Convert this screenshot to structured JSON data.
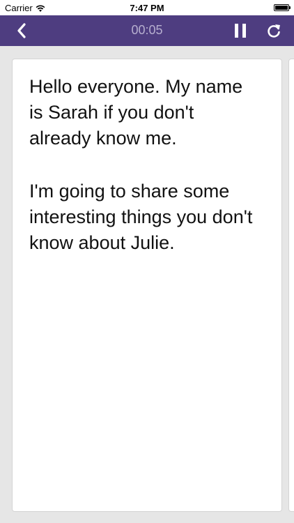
{
  "status_bar": {
    "carrier": "Carrier",
    "time": "7:47 PM",
    "wifi_icon": "wifi-icon",
    "battery_icon": "battery-icon"
  },
  "nav": {
    "back_icon": "chevron-left-icon",
    "timer": "00:05",
    "pause_icon": "pause-icon",
    "restart_icon": "refresh-icon"
  },
  "card": {
    "paragraphs": [
      "Hello everyone. My name is Sarah if you don't already know me.",
      "I'm going to share some interesting things you don't know about Julie."
    ]
  },
  "colors": {
    "nav_background": "#4e3d80",
    "timer_text": "#b7afcf",
    "page_background": "#e6e6e6",
    "card_background": "#ffffff"
  }
}
